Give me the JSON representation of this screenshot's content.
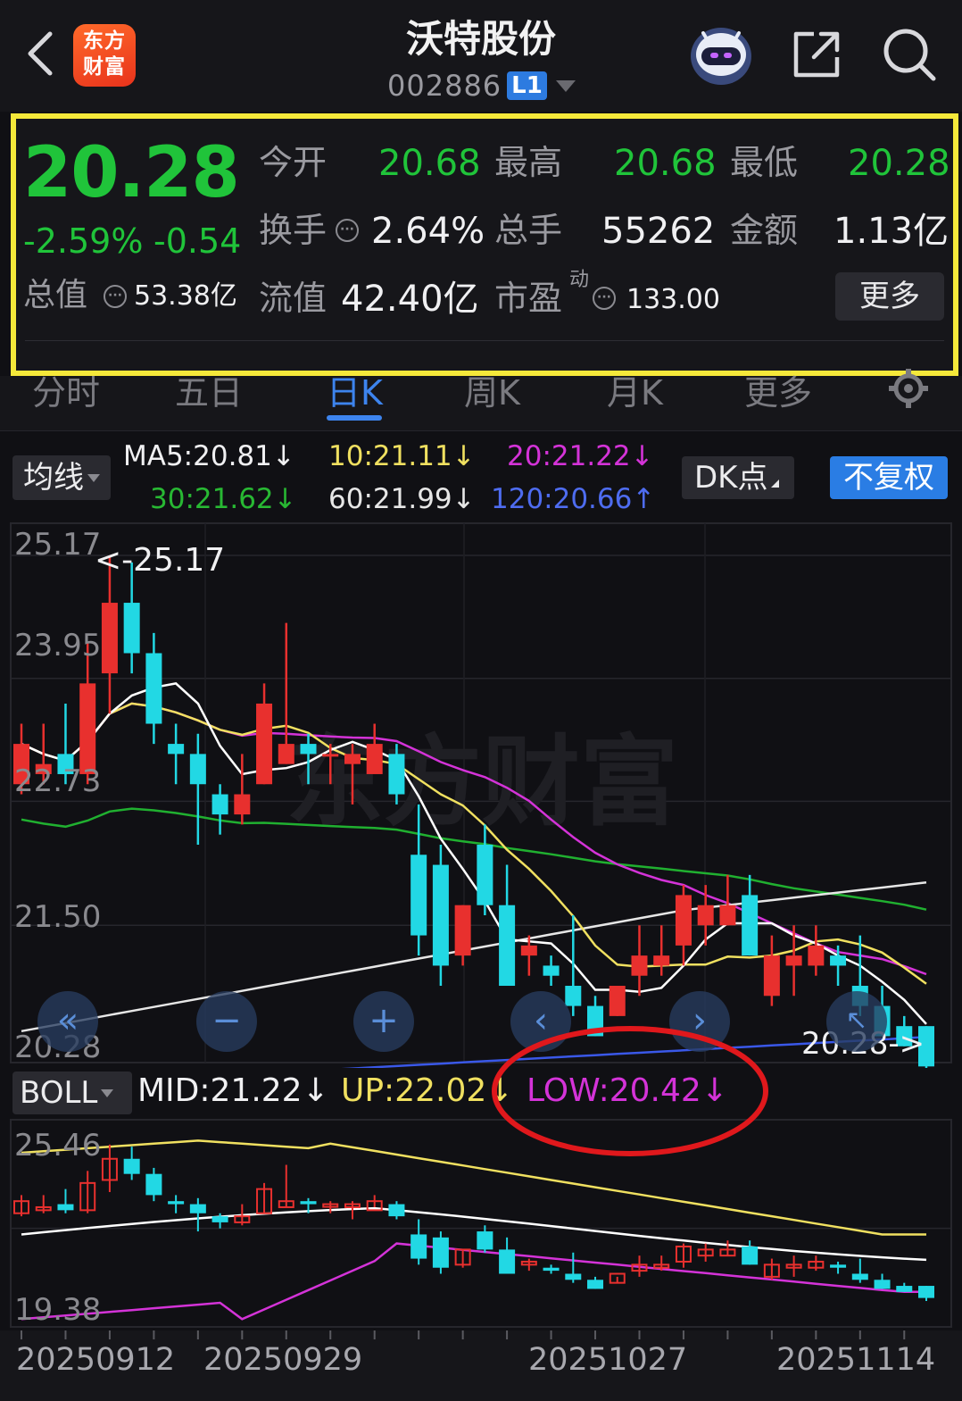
{
  "app": {
    "logo_text": "东方\n财富",
    "title": "沃特股份",
    "code": "002886",
    "level": "L1"
  },
  "quote": {
    "price": "20.28",
    "pct": "-2.59%",
    "chg": "-0.54",
    "open_label": "今开",
    "open": "20.68",
    "high_label": "最高",
    "high": "20.68",
    "low_label": "最低",
    "low": "20.28",
    "turnover_label": "换手",
    "turnover": "2.64%",
    "volume_label": "总手",
    "volume": "55262",
    "amount_label": "金额",
    "amount": "1.13亿",
    "mktcap_label": "总值",
    "mktcap": "53.38亿",
    "float_label": "流值",
    "float": "42.40亿",
    "pe_label": "市盈",
    "pe_sup": "动",
    "pe": "133.00",
    "more_label": "更多"
  },
  "tabs": [
    {
      "label": "分时"
    },
    {
      "label": "五日"
    },
    {
      "label": "日K",
      "active": true
    },
    {
      "label": "周K"
    },
    {
      "label": "月K"
    },
    {
      "label": "更多"
    }
  ],
  "ma": {
    "selector": "均线",
    "ma5": "MA5:20.81↓",
    "ma10": "10:21.11↓",
    "ma20": "20:21.22↓",
    "ma30": "30:21.62↓",
    "ma60": "60:21.99↓",
    "ma120": "120:20.66↑",
    "dk_label": "DK点",
    "adjust_label": "不复权"
  },
  "main_chart": {
    "y_ticks": [
      "25.17",
      "23.95",
      "22.73",
      "21.50",
      "20.28"
    ],
    "max_label": "<-25.17",
    "last_label": "20.28->",
    "watermark": "东方财富"
  },
  "boll": {
    "selector": "BOLL",
    "mid": "MID:21.22↓",
    "up": "UP:22.02↓",
    "low": "LOW:20.42↓",
    "y_ticks": [
      "25.46",
      "19.38"
    ]
  },
  "x_axis": [
    "20250912",
    "20250929",
    "20251027",
    "20251114"
  ],
  "colors": {
    "up": "#e8302e",
    "down": "#22d8e4",
    "ma5": "#ffffff",
    "ma10": "#f0e060",
    "ma20": "#d433d8",
    "ma30": "#20b030",
    "ma60": "#e6e6e6",
    "ma120": "#3a58e8",
    "highlight_box": "#f5e83a",
    "annotation_ellipse": "#e0181c"
  },
  "chart_data": {
    "type": "candlestick",
    "series": [
      {
        "name": "K",
        "ohlc": [
          [
            22.9,
            23.5,
            22.8,
            23.3
          ],
          [
            23.0,
            23.5,
            22.9,
            23.1
          ],
          [
            23.2,
            23.7,
            22.9,
            23.0
          ],
          [
            23.0,
            24.3,
            22.9,
            23.9
          ],
          [
            24.0,
            25.17,
            23.6,
            24.7
          ],
          [
            24.7,
            25.1,
            24.0,
            24.2
          ],
          [
            24.2,
            24.4,
            23.3,
            23.5
          ],
          [
            23.3,
            23.5,
            22.9,
            23.2
          ],
          [
            23.2,
            23.4,
            22.3,
            22.9
          ],
          [
            22.8,
            22.9,
            22.4,
            22.6
          ],
          [
            22.6,
            23.2,
            22.5,
            22.8
          ],
          [
            22.9,
            23.9,
            22.9,
            23.7
          ],
          [
            23.1,
            24.5,
            23.1,
            23.3
          ],
          [
            23.3,
            23.4,
            22.9,
            23.2
          ],
          [
            23.2,
            23.3,
            22.9,
            23.2
          ],
          [
            23.1,
            23.3,
            22.7,
            23.2
          ],
          [
            23.0,
            23.5,
            23.1,
            23.3
          ],
          [
            23.2,
            23.3,
            22.7,
            22.8
          ],
          [
            22.2,
            22.7,
            21.2,
            21.4
          ],
          [
            22.1,
            22.3,
            20.9,
            21.1
          ],
          [
            21.2,
            21.7,
            21.1,
            21.7
          ],
          [
            22.3,
            22.5,
            21.6,
            21.7
          ],
          [
            21.7,
            22.1,
            20.9,
            20.9
          ],
          [
            21.2,
            21.4,
            21.0,
            21.3
          ],
          [
            21.1,
            21.2,
            20.9,
            21.0
          ],
          [
            20.9,
            21.6,
            20.6,
            20.7
          ],
          [
            20.7,
            20.8,
            20.4,
            20.4
          ],
          [
            20.6,
            20.8,
            20.6,
            20.9
          ],
          [
            21.0,
            21.5,
            20.8,
            21.2
          ],
          [
            21.1,
            21.5,
            21.0,
            21.2
          ],
          [
            21.3,
            21.9,
            21.1,
            21.8
          ],
          [
            21.5,
            21.9,
            21.3,
            21.7
          ],
          [
            21.5,
            22.0,
            21.5,
            21.7
          ],
          [
            21.8,
            22.0,
            21.2,
            21.2
          ],
          [
            20.8,
            21.4,
            20.7,
            21.2
          ],
          [
            21.1,
            21.5,
            20.8,
            21.2
          ],
          [
            21.1,
            21.5,
            21.0,
            21.3
          ],
          [
            21.2,
            21.3,
            20.9,
            21.1
          ],
          [
            20.9,
            21.4,
            20.6,
            20.7
          ],
          [
            20.7,
            20.9,
            20.4,
            20.4
          ],
          [
            20.5,
            20.6,
            20.3,
            20.3
          ],
          [
            20.5,
            20.5,
            20.0,
            20.1
          ]
        ]
      }
    ],
    "x_range": [
      "20250912",
      "20251114"
    ],
    "ylim": [
      20.28,
      25.17
    ]
  }
}
